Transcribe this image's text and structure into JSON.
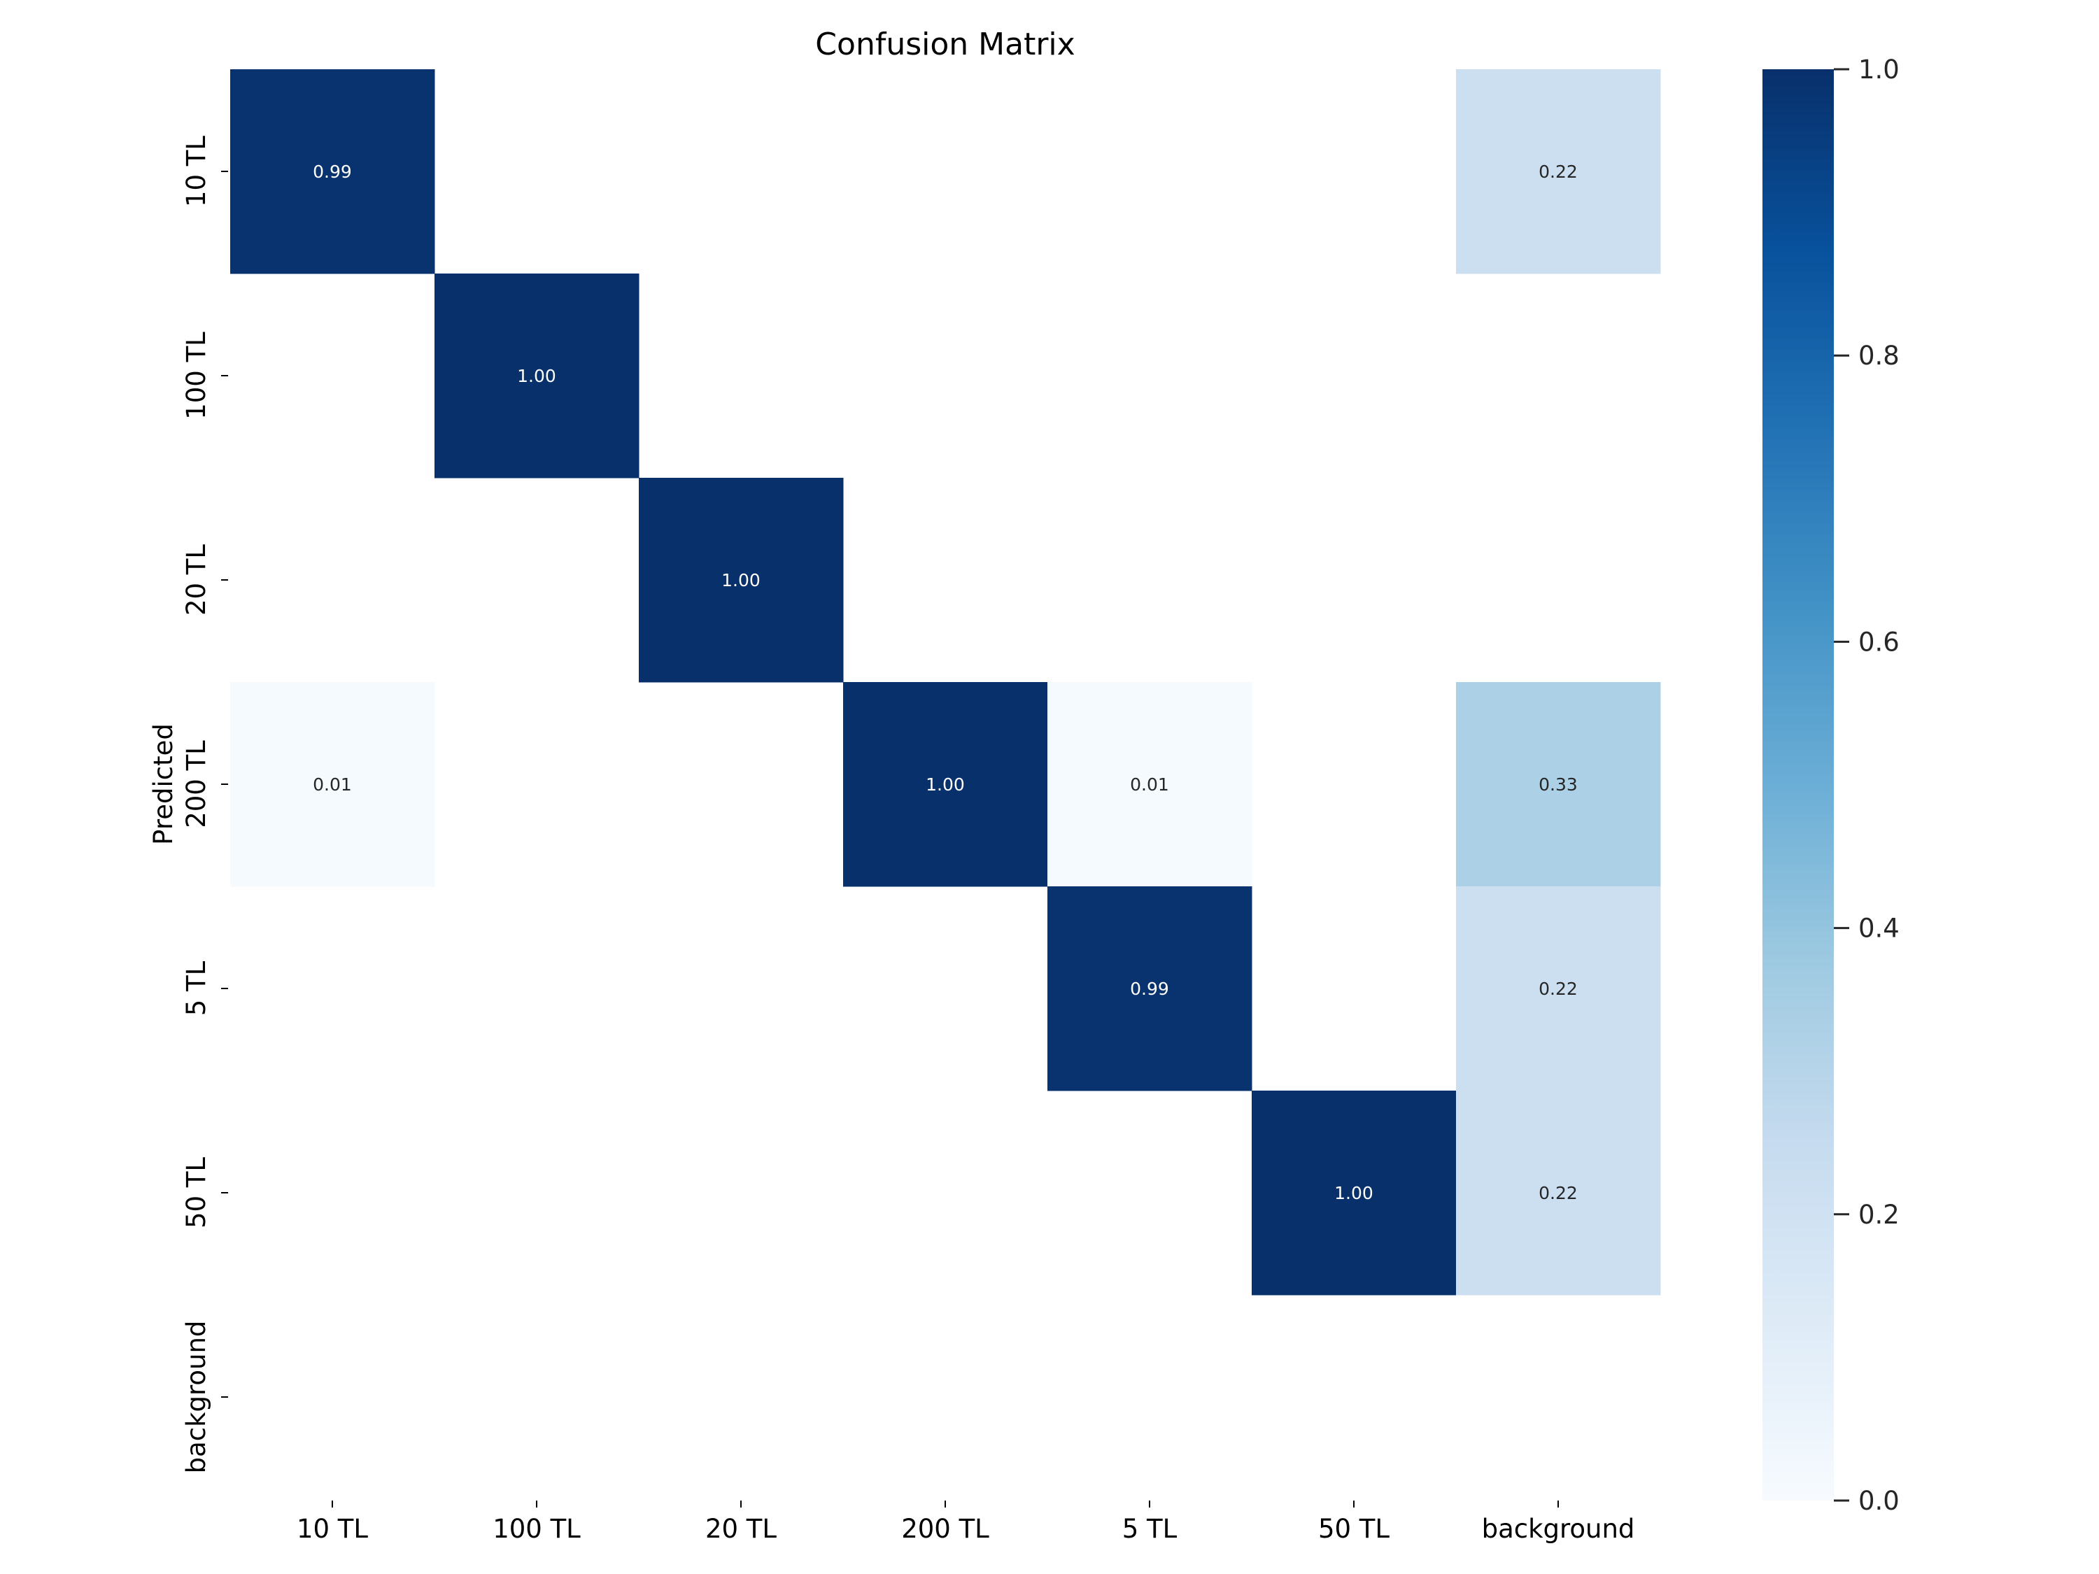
{
  "chart_data": {
    "type": "heatmap",
    "title": "Confusion Matrix",
    "xlabel": "",
    "ylabel": "Predicted",
    "x_categories": [
      "10 TL",
      "100 TL",
      "20 TL",
      "200 TL",
      "5 TL",
      "50 TL",
      "background"
    ],
    "y_categories": [
      "10 TL",
      "100 TL",
      "20 TL",
      "200 TL",
      "5 TL",
      "50 TL",
      "background"
    ],
    "values": [
      [
        0.99,
        null,
        null,
        null,
        null,
        null,
        0.22
      ],
      [
        null,
        1.0,
        null,
        null,
        null,
        null,
        null
      ],
      [
        null,
        null,
        1.0,
        null,
        null,
        null,
        null
      ],
      [
        0.01,
        null,
        null,
        1.0,
        0.01,
        null,
        0.33
      ],
      [
        null,
        null,
        null,
        null,
        0.99,
        null,
        0.22
      ],
      [
        null,
        null,
        null,
        null,
        null,
        1.0,
        0.22
      ],
      [
        null,
        null,
        null,
        null,
        null,
        null,
        null
      ]
    ],
    "value_format": "2 decimals",
    "colormap": "Blues",
    "vmin": 0.0,
    "vmax": 1.0,
    "colorbar": {
      "ticks": [
        0.0,
        0.2,
        0.4,
        0.6,
        0.8,
        1.0
      ],
      "tick_labels": [
        "0.0",
        "0.2",
        "0.4",
        "0.6",
        "0.8",
        "1.0"
      ],
      "placement": "right"
    },
    "colors": {
      "low": "#f7fbff",
      "high": "#08306b",
      "text_light": "#ffffff",
      "text_dark": "#262626"
    },
    "grid": false
  }
}
